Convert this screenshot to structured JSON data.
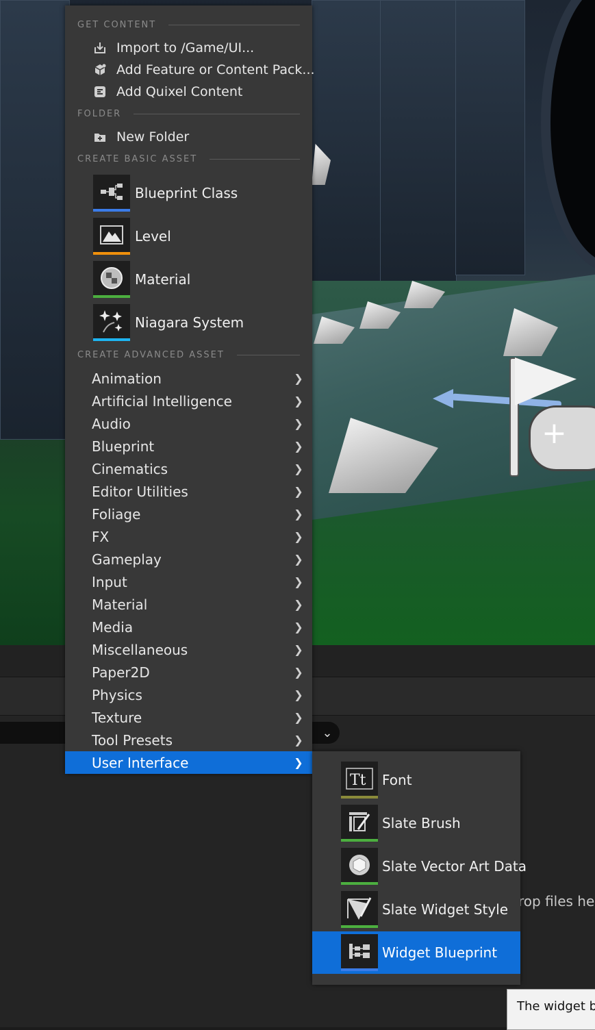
{
  "colors": {
    "menu_bg": "#383838",
    "selection": "#0f6ed8",
    "section_text": "#8a8a8a",
    "blueprint_class": "#3b7ce8",
    "level": "#f0900c",
    "material": "#4caf3f",
    "niagara": "#1eb4f0",
    "font_bar": "#8a8a3a",
    "slate_bar": "#4caf3f"
  },
  "get_content": {
    "header": "GET CONTENT",
    "items": [
      {
        "label": "Import to /Game/UI...",
        "icon": "import-icon"
      },
      {
        "label": "Add Feature or Content Pack...",
        "icon": "content-pack-icon"
      },
      {
        "label": "Add Quixel Content",
        "icon": "quixel-icon"
      }
    ]
  },
  "folder": {
    "header": "FOLDER",
    "items": [
      {
        "label": "New Folder",
        "icon": "new-folder-icon"
      }
    ]
  },
  "basic_asset": {
    "header": "CREATE BASIC ASSET",
    "items": [
      {
        "label": "Blueprint Class",
        "icon": "blueprint-class-icon"
      },
      {
        "label": "Level",
        "icon": "level-icon"
      },
      {
        "label": "Material",
        "icon": "material-icon"
      },
      {
        "label": "Niagara System",
        "icon": "niagara-system-icon"
      }
    ]
  },
  "advanced_asset": {
    "header": "CREATE ADVANCED ASSET",
    "items": [
      {
        "label": "Animation"
      },
      {
        "label": "Artificial Intelligence"
      },
      {
        "label": "Audio"
      },
      {
        "label": "Blueprint"
      },
      {
        "label": "Cinematics"
      },
      {
        "label": "Editor Utilities"
      },
      {
        "label": "Foliage"
      },
      {
        "label": "FX"
      },
      {
        "label": "Gameplay"
      },
      {
        "label": "Input"
      },
      {
        "label": "Material"
      },
      {
        "label": "Media"
      },
      {
        "label": "Miscellaneous"
      },
      {
        "label": "Paper2D"
      },
      {
        "label": "Physics"
      },
      {
        "label": "Texture"
      },
      {
        "label": "Tool Presets"
      },
      {
        "label": "User Interface",
        "selected": true
      }
    ]
  },
  "submenu": {
    "items": [
      {
        "label": "Font",
        "icon": "font-icon"
      },
      {
        "label": "Slate Brush",
        "icon": "slate-brush-icon"
      },
      {
        "label": "Slate Vector Art Data",
        "icon": "slate-vector-art-icon"
      },
      {
        "label": "Slate Widget Style",
        "icon": "slate-widget-style-icon"
      },
      {
        "label": "Widget Blueprint",
        "icon": "widget-blueprint-icon",
        "selected": true
      }
    ]
  },
  "content_browser": {
    "drop_hint": "rop files here",
    "tooltip": "The widget blu"
  }
}
